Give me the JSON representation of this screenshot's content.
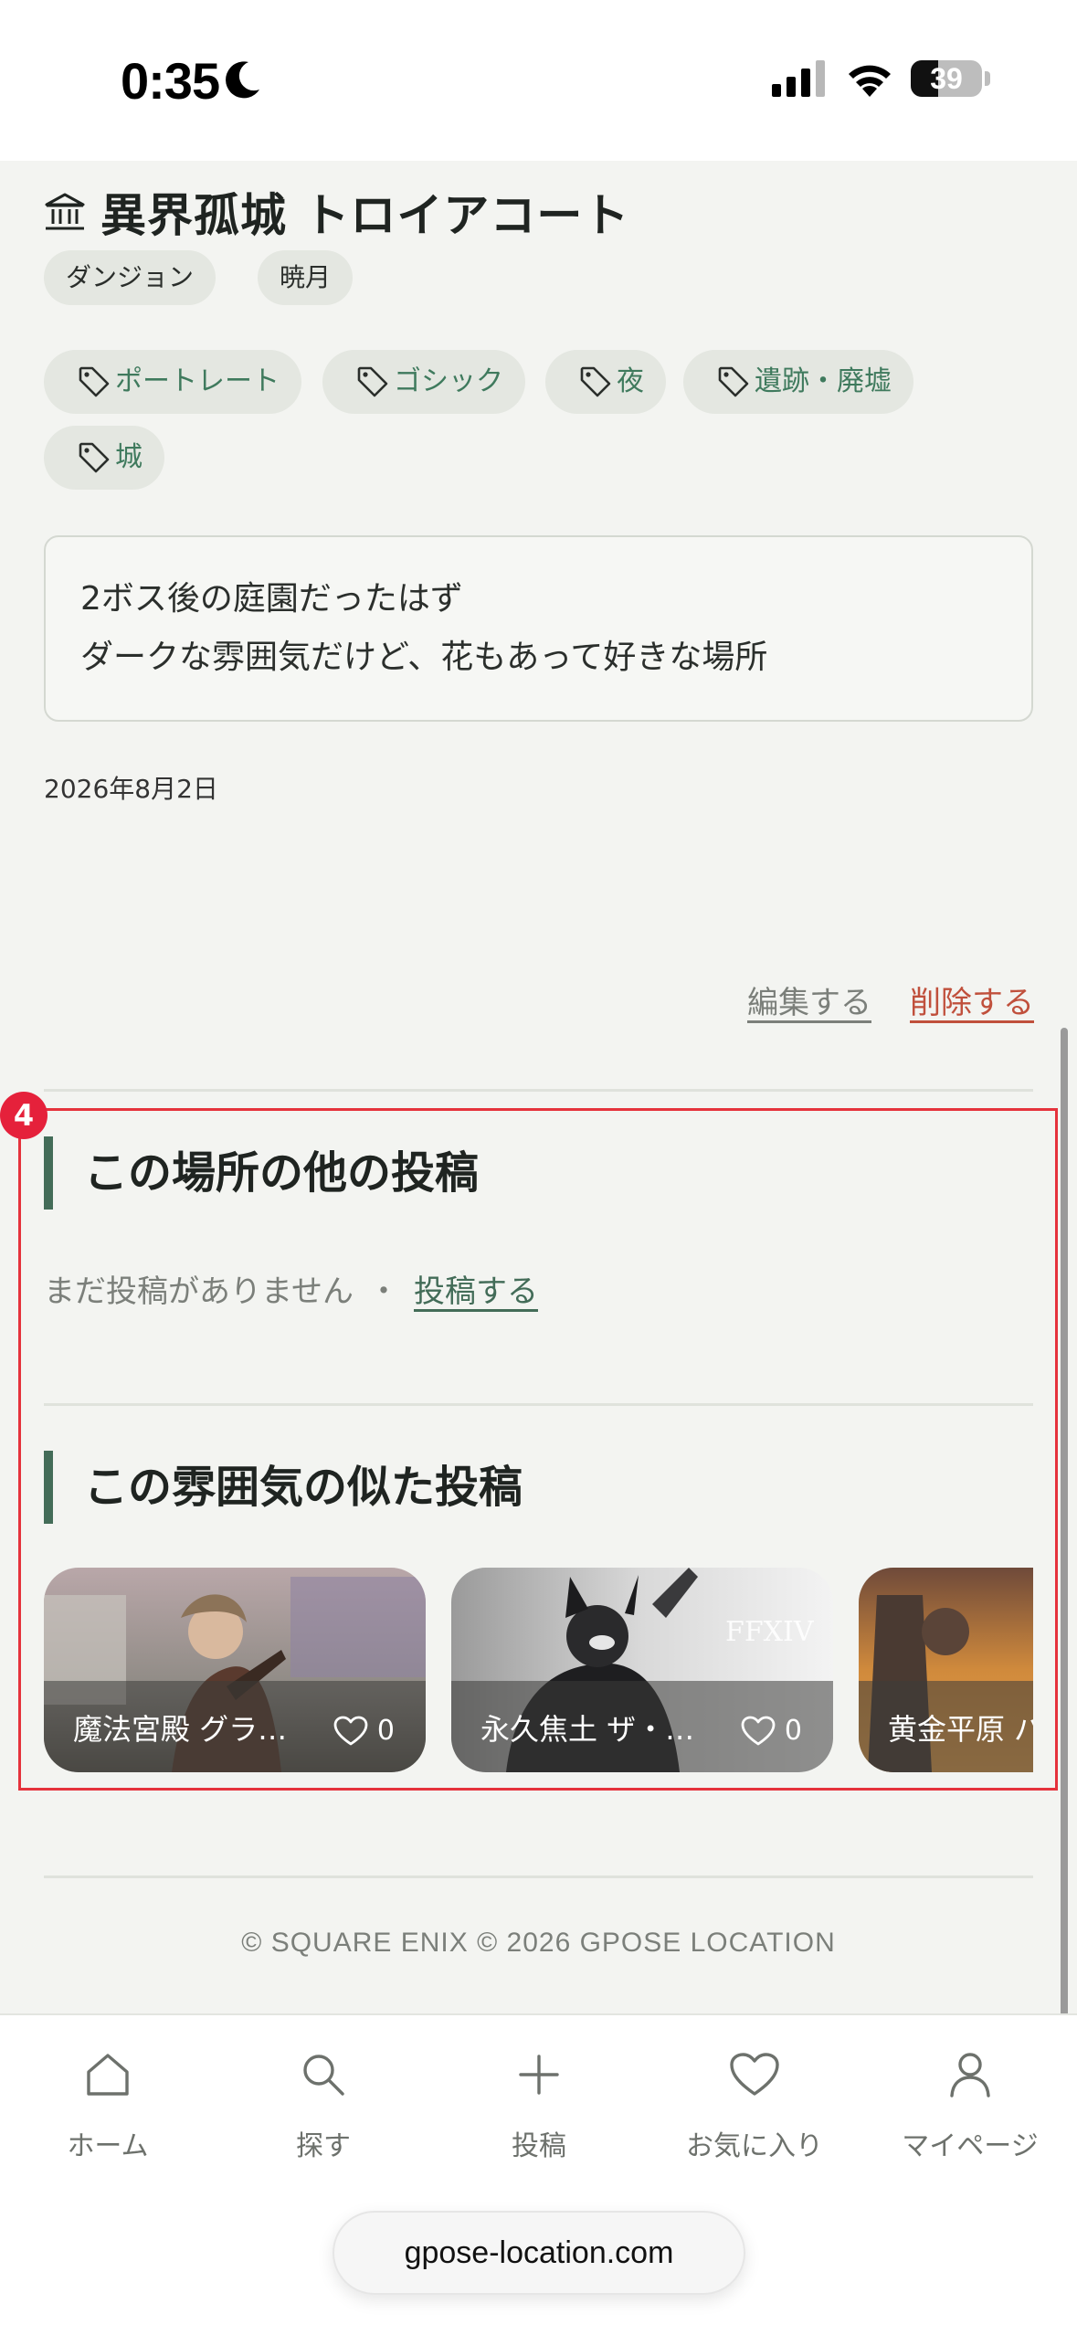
{
  "status_bar": {
    "time": "0:35",
    "battery": "39",
    "battery_level": 0.39
  },
  "spot": {
    "title": "異界孤城 トロイアコート",
    "chips": [
      "ダンジョン",
      "暁月"
    ],
    "tags": [
      "ポートレート",
      "ゴシック",
      "夜",
      "遺跡・廃墟",
      "城"
    ],
    "description_lines": [
      "2ボス後の庭園だったはず",
      "ダークな雰囲気だけど、花もあって好きな場所"
    ],
    "date": "2026年8月2日",
    "edit_label": "編集する",
    "delete_label": "削除する"
  },
  "highlight_badge": "4",
  "other_posts": {
    "heading": "この場所の他の投稿",
    "empty_text": "まだ投稿がありません",
    "separator": "・",
    "post_link": "投稿する"
  },
  "similar_posts": {
    "heading": "この雰囲気の似た投稿",
    "cards": [
      {
        "name": "魔法宮殿 グラ…",
        "likes": "0"
      },
      {
        "name": "永久焦土 ザ・…",
        "likes": "0"
      },
      {
        "name": "黄金平原 パ",
        "likes": ""
      }
    ]
  },
  "footer": {
    "copyright": "© SQUARE ENIX © 2026 GPOSE LOCATION"
  },
  "nav": {
    "items": [
      {
        "label": "ホーム",
        "icon": "home-icon"
      },
      {
        "label": "探す",
        "icon": "search-icon"
      },
      {
        "label": "投稿",
        "icon": "plus-icon"
      },
      {
        "label": "お気に入り",
        "icon": "heart-icon"
      },
      {
        "label": "マイページ",
        "icon": "user-icon"
      }
    ]
  },
  "browser": {
    "url": "gpose-location.com"
  }
}
